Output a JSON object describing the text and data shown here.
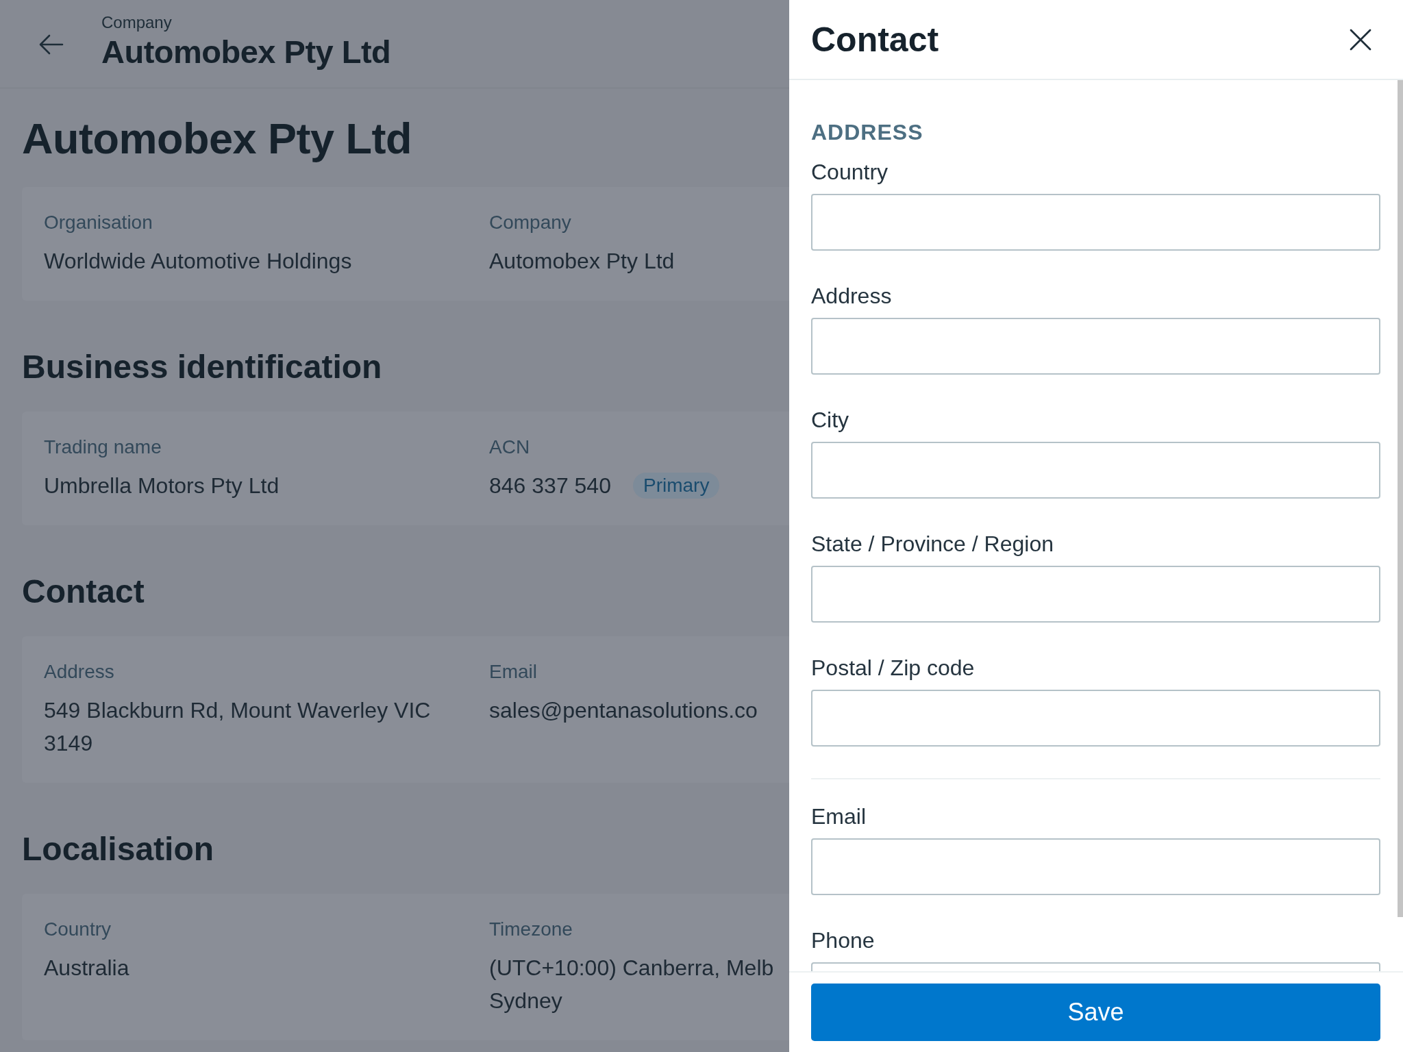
{
  "header": {
    "eyebrow": "Company",
    "title": "Automobex Pty Ltd"
  },
  "page_title": "Automobex Pty Ltd",
  "sections": [
    {
      "fields": [
        {
          "label": "Organisation",
          "lines": [
            "Worldwide Automotive Holdings"
          ]
        },
        {
          "label": "Company",
          "lines": [
            "Automobex Pty Ltd"
          ]
        }
      ]
    },
    {
      "heading": "Business identification",
      "fields": [
        {
          "label": "Trading name",
          "lines": [
            "Umbrella Motors Pty Ltd"
          ]
        },
        {
          "label": "ACN",
          "lines": [
            "846 337 540"
          ],
          "badge": "Primary"
        }
      ]
    },
    {
      "heading": "Contact",
      "fields": [
        {
          "label": "Address",
          "lines": [
            "549 Blackburn Rd, Mount Waverley VIC 3149"
          ]
        },
        {
          "label": "Email",
          "lines": [
            "sales@pentanasolutions.co"
          ]
        }
      ]
    },
    {
      "heading": "Localisation",
      "fields": [
        {
          "label": "Country",
          "lines": [
            "Australia"
          ]
        },
        {
          "label": "Timezone",
          "lines": [
            "(UTC+10:00) Canberra, Melb",
            "Sydney"
          ]
        }
      ]
    }
  ],
  "drawer": {
    "title": "Contact",
    "groups": [
      {
        "heading": "ADDRESS",
        "fields": [
          {
            "label": "Country"
          },
          {
            "label": "Address"
          },
          {
            "label": "City"
          },
          {
            "label": "State / Province / Region"
          },
          {
            "label": "Postal / Zip code"
          }
        ]
      },
      {
        "fields": [
          {
            "label": "Email"
          },
          {
            "label": "Phone"
          }
        ]
      }
    ],
    "save_button": "Save"
  }
}
